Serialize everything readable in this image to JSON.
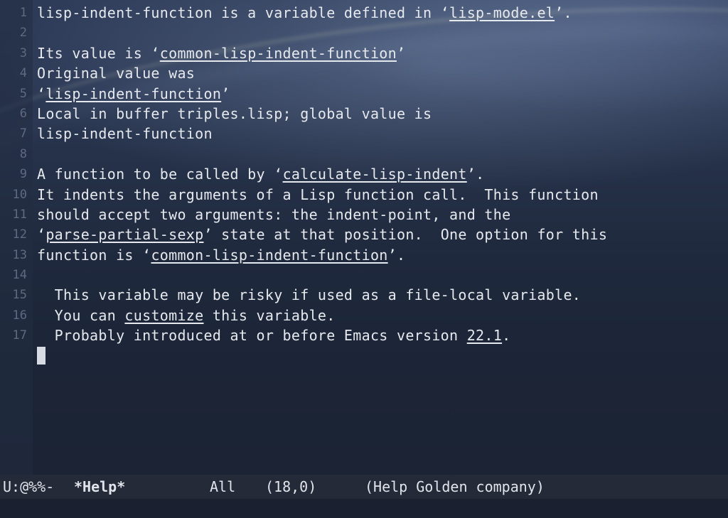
{
  "buffer": {
    "lines": [
      {
        "num": "1",
        "segments": [
          {
            "t": "lisp-indent-function is a variable defined in ‘"
          },
          {
            "t": "lisp-mode.el",
            "link": true
          },
          {
            "t": "’."
          }
        ]
      },
      {
        "num": "2",
        "segments": [
          {
            "t": ""
          }
        ]
      },
      {
        "num": "3",
        "segments": [
          {
            "t": "Its value is ‘"
          },
          {
            "t": "common-lisp-indent-function",
            "link": true
          },
          {
            "t": "’"
          }
        ]
      },
      {
        "num": "4",
        "segments": [
          {
            "t": "Original value was"
          }
        ]
      },
      {
        "num": "5",
        "segments": [
          {
            "t": "‘"
          },
          {
            "t": "lisp-indent-function",
            "link": true
          },
          {
            "t": "’"
          }
        ]
      },
      {
        "num": "6",
        "segments": [
          {
            "t": "Local in buffer triples.lisp; global value is"
          }
        ]
      },
      {
        "num": "7",
        "segments": [
          {
            "t": "lisp-indent-function"
          }
        ]
      },
      {
        "num": "8",
        "segments": [
          {
            "t": ""
          }
        ]
      },
      {
        "num": "9",
        "segments": [
          {
            "t": "A function to be called by ‘"
          },
          {
            "t": "calculate-lisp-indent",
            "link": true
          },
          {
            "t": "’."
          }
        ]
      },
      {
        "num": "10",
        "segments": [
          {
            "t": "It indents the arguments of a Lisp function call.  This function"
          }
        ]
      },
      {
        "num": "11",
        "segments": [
          {
            "t": "should accept two arguments: the indent-point, and the"
          }
        ]
      },
      {
        "num": "12",
        "segments": [
          {
            "t": "‘"
          },
          {
            "t": "parse-partial-sexp",
            "link": true
          },
          {
            "t": "’ state at that position.  One option for this"
          }
        ]
      },
      {
        "num": "13",
        "segments": [
          {
            "t": "function is ‘"
          },
          {
            "t": "common-lisp-indent-function",
            "link": true
          },
          {
            "t": "’."
          }
        ]
      },
      {
        "num": "14",
        "segments": [
          {
            "t": ""
          }
        ]
      },
      {
        "num": "15",
        "segments": [
          {
            "t": "  This variable may be risky if used as a file-local variable."
          }
        ]
      },
      {
        "num": "16",
        "segments": [
          {
            "t": "  You can "
          },
          {
            "t": "customize",
            "link": true
          },
          {
            "t": " this variable."
          }
        ]
      },
      {
        "num": "17",
        "segments": [
          {
            "t": "  Probably introduced at or before Emacs version "
          },
          {
            "t": "22.1",
            "link": true
          },
          {
            "t": "."
          }
        ]
      }
    ]
  },
  "modeline": {
    "status": "U:@%%-",
    "buffer_name": "*Help*",
    "position": "All",
    "cursor_pos": "(18,0)",
    "modes": "(Help Golden company)"
  },
  "colors": {
    "text": "#e6e9ee",
    "line_number": "#5d6a82",
    "modeline_bg": "#252a38"
  }
}
